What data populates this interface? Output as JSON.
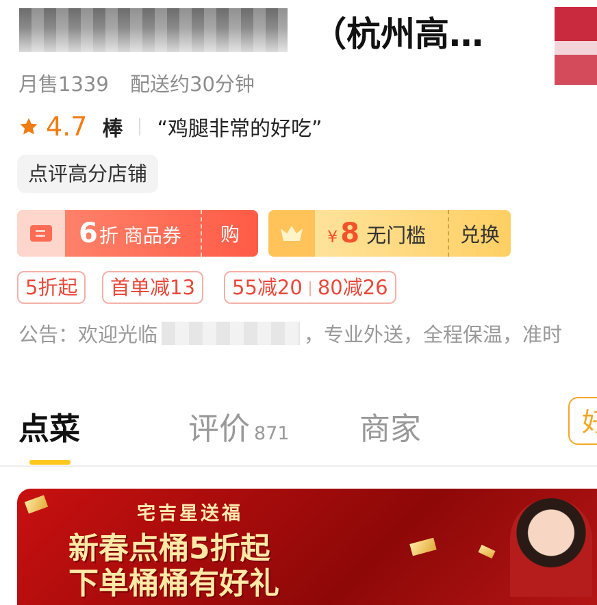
{
  "store": {
    "title_suffix": "（杭州高…",
    "monthly_sales": "月售1339",
    "delivery": "配送约30分钟",
    "rating": "4.7",
    "praise": "棒",
    "review_quote": "“鸡腿非常的好吃”",
    "tag": "点评高分店铺"
  },
  "coupons": {
    "discount": {
      "value": "6",
      "unit": "折",
      "name": "商品券",
      "action": "购"
    },
    "exchange": {
      "currency": "¥",
      "value": "8",
      "name": "无门槛",
      "action": "兑换"
    }
  },
  "promos": {
    "p1": "5折起",
    "p2": "首单减13",
    "p3a": "55减20",
    "p3b": "80减26"
  },
  "notice": {
    "prefix": "公告：欢迎光临",
    "suffix": "，专业外送，全程保温，准时"
  },
  "tabs": {
    "order": "点菜",
    "reviews": "评价",
    "reviews_count": "871",
    "merchant": "商家",
    "corner": "好"
  },
  "banner": {
    "top": "宅吉星送福",
    "line1": "新春点桶5折起",
    "line2": "下单桶桶有好礼"
  },
  "colors": {
    "accent_orange": "#f07c12",
    "promo_red": "#e9483a",
    "tab_indicator": "#ffc820"
  }
}
